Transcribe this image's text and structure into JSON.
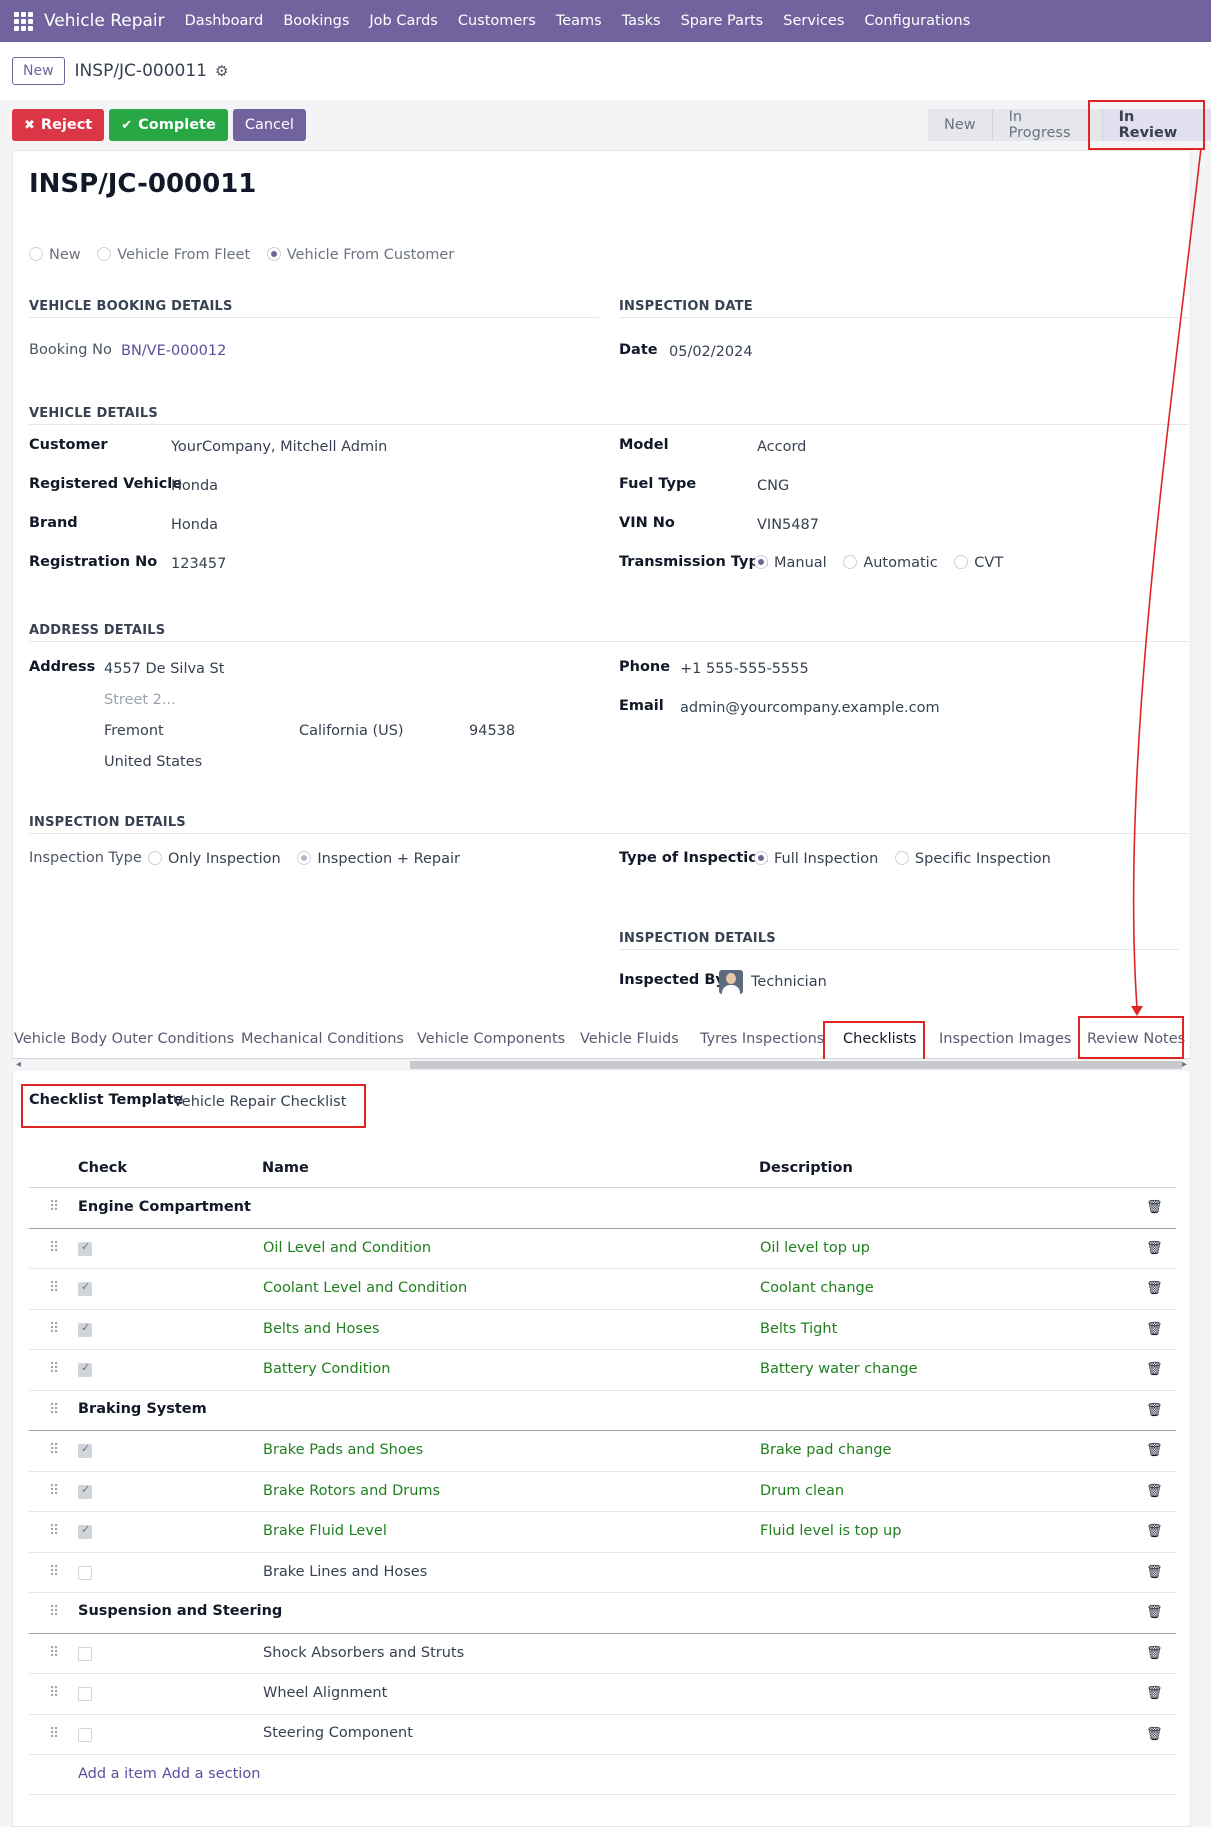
{
  "app": {
    "name": "Vehicle Repair",
    "menu": [
      "Dashboard",
      "Bookings",
      "Job Cards",
      "Customers",
      "Teams",
      "Tasks",
      "Spare Parts",
      "Services",
      "Configurations"
    ]
  },
  "control": {
    "new_label": "New",
    "breadcrumb": "INSP/JC-000011"
  },
  "actions": {
    "reject": "Reject",
    "complete": "Complete",
    "cancel": "Cancel"
  },
  "status": {
    "stages": [
      "New",
      "In Progress",
      "In Review"
    ],
    "current": "In Review"
  },
  "record": {
    "title": "INSP/JC-000011",
    "source_options": [
      "New",
      "Vehicle From Fleet",
      "Vehicle From Customer"
    ],
    "source_selected": "Vehicle From Customer"
  },
  "booking": {
    "heading": "VEHICLE BOOKING DETAILS",
    "booking_label": "Booking No",
    "booking_no": "BN/VE-000012"
  },
  "inspection_date": {
    "heading": "INSPECTION DATE",
    "date_label": "Date",
    "date": "05/02/2024"
  },
  "vehicle": {
    "heading": "VEHICLE DETAILS",
    "customer_label": "Customer",
    "customer": "YourCompany, Mitchell Admin",
    "registered_label": "Registered Vehicle",
    "registered": "Honda",
    "brand_label": "Brand",
    "brand": "Honda",
    "regno_label": "Registration No",
    "regno": "123457",
    "model_label": "Model",
    "model": "Accord",
    "fuel_label": "Fuel Type",
    "fuel": "CNG",
    "vin_label": "VIN No",
    "vin": "VIN5487",
    "transmission_label": "Transmission Type",
    "transmission_options": [
      "Manual",
      "Automatic",
      "CVT"
    ],
    "transmission_selected": "Manual"
  },
  "address": {
    "heading": "ADDRESS DETAILS",
    "address_label": "Address",
    "street": "4557 De Silva St",
    "street2_placeholder": "Street 2...",
    "city": "Fremont",
    "state": "California (US)",
    "zip": "94538",
    "country": "United States",
    "phone_label": "Phone",
    "phone": "+1 555-555-5555",
    "email_label": "Email",
    "email": "admin@yourcompany.example.com"
  },
  "inspection": {
    "heading": "INSPECTION DETAILS",
    "type_label": "Inspection Type",
    "type_options": [
      "Only Inspection",
      "Inspection + Repair"
    ],
    "type_selected": "Inspection + Repair",
    "kind_label": "Type of Inspection",
    "kind_options": [
      "Full Inspection",
      "Specific Inspection"
    ],
    "kind_selected": "Full Inspection",
    "details_heading": "INSPECTION DETAILS",
    "inspected_by_label": "Inspected By",
    "inspected_by": "Technician"
  },
  "tabs": [
    "Vehicle Body Outer Conditions",
    "Mechanical Conditions",
    "Vehicle Components",
    "Vehicle Fluids",
    "Tyres Inspections",
    "Checklists",
    "Inspection Images",
    "Review Notes"
  ],
  "active_tab": "Checklists",
  "checklist": {
    "template_label": "Checklist Template",
    "template": "Vehicle Repair Checklist",
    "columns": [
      "Check",
      "Name",
      "Description"
    ],
    "rows": [
      {
        "section": "Engine Compartment"
      },
      {
        "checked": true,
        "name": "Oil Level and Condition",
        "description": "Oil level top up"
      },
      {
        "checked": true,
        "name": "Coolant Level and Condition",
        "description": "Coolant change"
      },
      {
        "checked": true,
        "name": "Belts and Hoses",
        "description": "Belts Tight"
      },
      {
        "checked": true,
        "name": "Battery Condition",
        "description": "Battery water change"
      },
      {
        "section": "Braking System"
      },
      {
        "checked": true,
        "name": "Brake Pads and Shoes",
        "description": "Brake pad change"
      },
      {
        "checked": true,
        "name": "Brake Rotors and Drums",
        "description": "Drum clean"
      },
      {
        "checked": true,
        "name": "Brake Fluid Level",
        "description": "Fluid level is top up"
      },
      {
        "checked": false,
        "name": "Brake Lines and Hoses",
        "description": ""
      },
      {
        "section": "Suspension and Steering"
      },
      {
        "checked": false,
        "name": "Shock Absorbers and Struts",
        "description": ""
      },
      {
        "checked": false,
        "name": "Wheel Alignment",
        "description": ""
      },
      {
        "checked": false,
        "name": "Steering Component",
        "description": ""
      }
    ],
    "add_item": "Add a item",
    "add_section": "Add a section"
  },
  "colors": {
    "brand": "#71639e",
    "reject": "#dc3545",
    "complete": "#28a745",
    "checked_text": "#20801e",
    "annotation": "#e02424"
  },
  "icons": [
    "apps-icon",
    "gear-icon",
    "close-icon",
    "check-icon",
    "drag-handle-icon",
    "trash-icon",
    "avatar"
  ]
}
